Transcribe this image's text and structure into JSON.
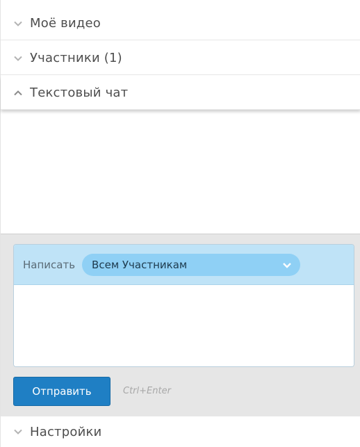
{
  "sections": {
    "video": {
      "label": "Моё видео",
      "icon": "chevron-down-icon",
      "expanded": false
    },
    "participants": {
      "label": "Участники (1)",
      "icon": "chevron-down-icon",
      "expanded": false
    },
    "chat": {
      "label": "Текстовый чат",
      "icon": "chevron-up-icon",
      "expanded": true
    },
    "settings": {
      "label": "Настройки",
      "icon": "chevron-down-icon",
      "expanded": false
    }
  },
  "compose": {
    "write_label": "Написать",
    "recipient": "Всем Участникам",
    "message_value": "",
    "send_label": "Отправить",
    "shortcut_hint": "Ctrl+Enter"
  },
  "colors": {
    "compose_header_bg": "#bfe3f7",
    "recipient_pill_bg": "#8fd0f5",
    "send_button_bg": "#1f7fc4",
    "panel_bg": "#e6e6e6"
  }
}
